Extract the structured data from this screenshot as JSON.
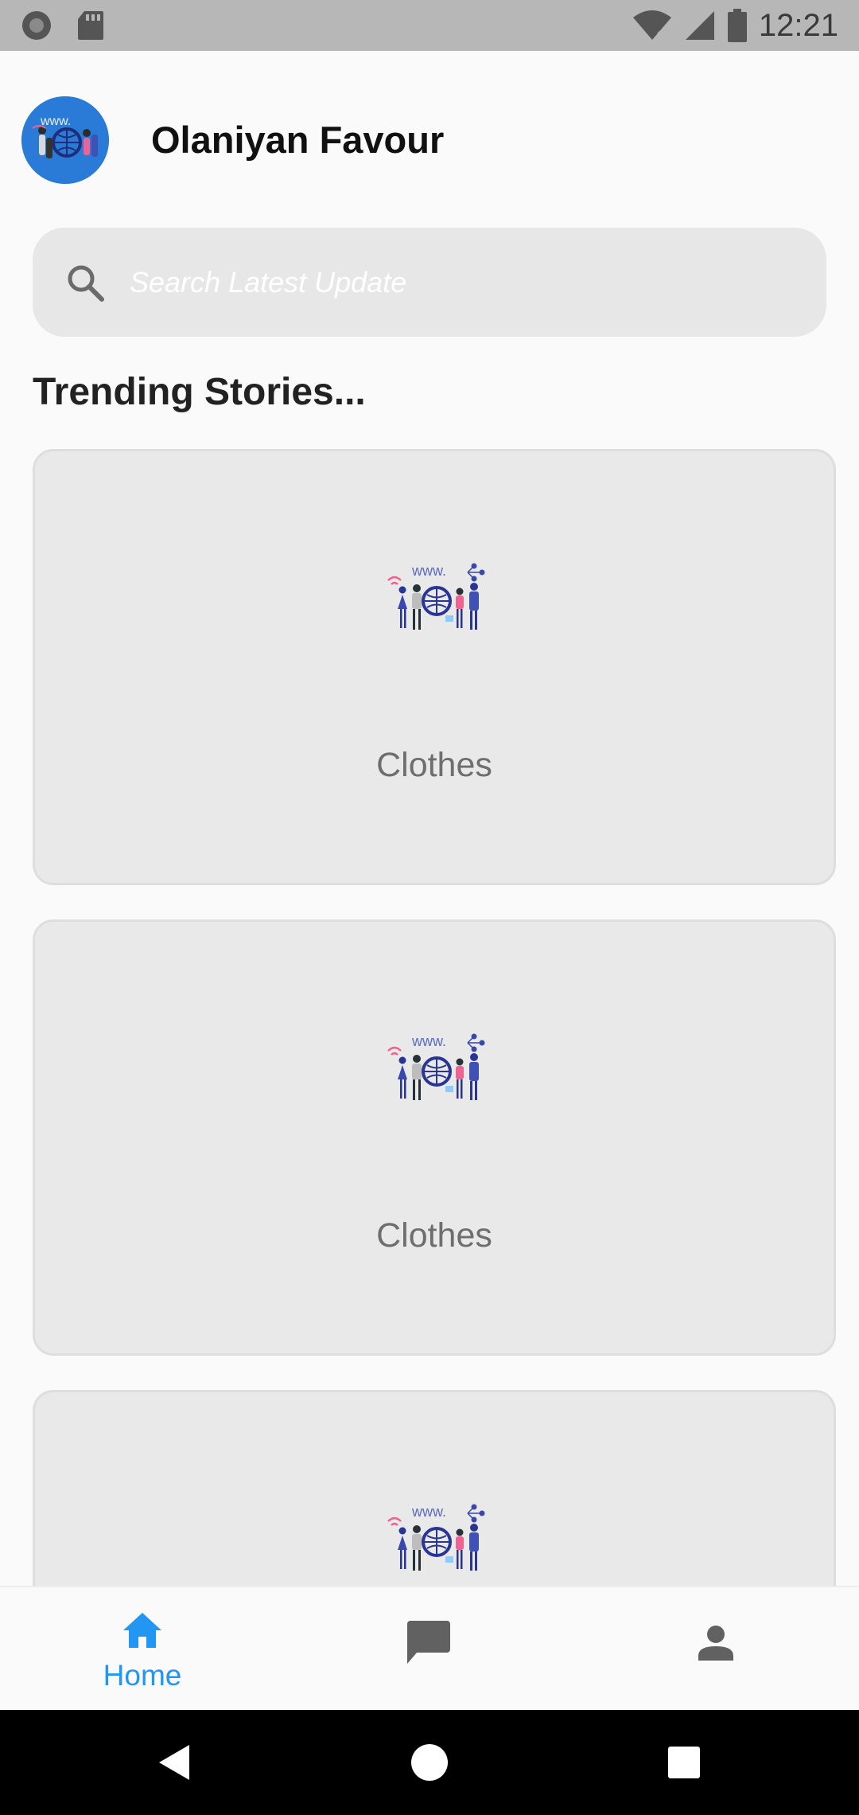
{
  "status_bar": {
    "time": "12:21",
    "icons": [
      "record-icon",
      "sd-card-icon",
      "wifi-icon",
      "cell-signal-icon",
      "battery-icon"
    ]
  },
  "header": {
    "user_name": "Olaniyan Favour",
    "avatar_text": "www."
  },
  "search": {
    "placeholder": "Search Latest Update"
  },
  "section": {
    "title": "Trending Stories..."
  },
  "stories": [
    {
      "label": "Clothes",
      "illustration_text": "www."
    },
    {
      "label": "Clothes",
      "illustration_text": "www."
    },
    {
      "label": "",
      "illustration_text": "www."
    }
  ],
  "bottom_nav": {
    "items": [
      {
        "label": "Home",
        "icon": "home-icon",
        "active": true
      },
      {
        "label": "",
        "icon": "chat-icon",
        "active": false
      },
      {
        "label": "",
        "icon": "profile-icon",
        "active": false
      }
    ],
    "active_color": "#2196f3",
    "inactive_color": "#616161"
  },
  "system_nav": [
    "back-icon",
    "home-circle-icon",
    "recents-icon"
  ]
}
